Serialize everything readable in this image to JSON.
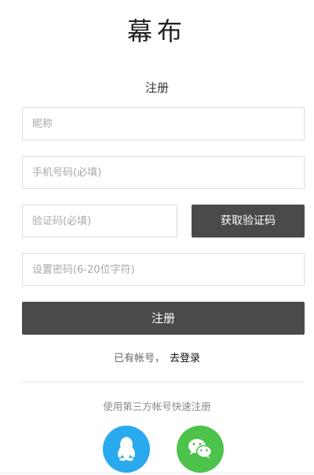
{
  "brand": {
    "logo_text": "幕布"
  },
  "form": {
    "title": "注册",
    "nickname_placeholder": "昵称",
    "phone_placeholder": "手机号码(必填)",
    "code_placeholder": "验证码(必填)",
    "get_code_label": "获取验证码",
    "password_placeholder": "设置密码(6-20位字符)",
    "submit_label": "注册"
  },
  "login": {
    "prompt": "已有帐号，",
    "link_label": "去登录"
  },
  "third_party": {
    "title": "使用第三方帐号快速注册",
    "providers": [
      {
        "name": "QQ",
        "icon": "qq-penguin-icon",
        "color": "#29a9ee"
      },
      {
        "name": "WeChat",
        "icon": "wechat-icon",
        "color": "#4cc34a"
      }
    ]
  }
}
